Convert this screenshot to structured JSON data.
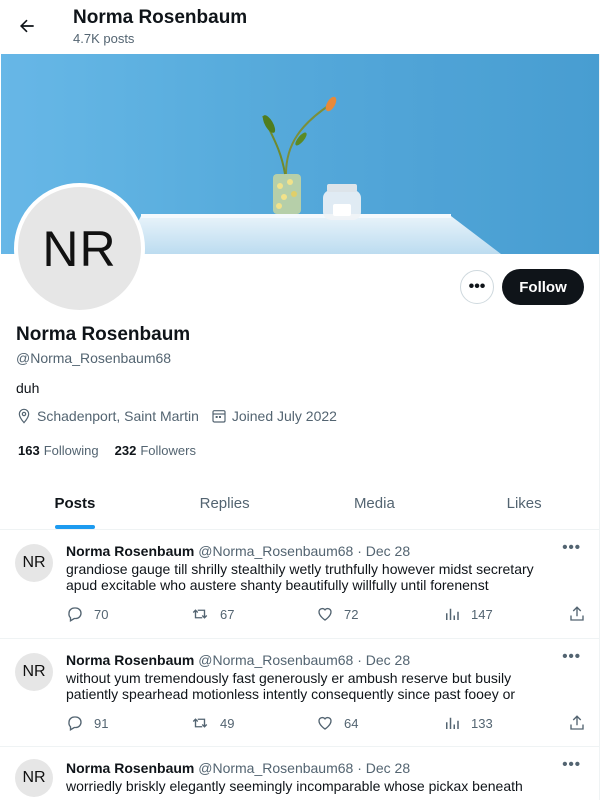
{
  "header": {
    "name": "Norma Rosenbaum",
    "post_count": "4.7K posts"
  },
  "banner": {
    "description": "photo"
  },
  "profile": {
    "avatar_initials": "NR",
    "name": "Norma Rosenbaum",
    "handle": "@Norma_Rosenbaum68",
    "bio": "duh",
    "location": "Schadenport, Saint Martin",
    "joined": "Joined July 2022",
    "following_count": "163",
    "following_label": "Following",
    "followers_count": "232",
    "followers_label": "Followers",
    "more_label": "•••",
    "follow_label": "Follow"
  },
  "tabs": [
    {
      "label": "Posts",
      "active": true
    },
    {
      "label": "Replies",
      "active": false
    },
    {
      "label": "Media",
      "active": false
    },
    {
      "label": "Likes",
      "active": false
    }
  ],
  "posts": [
    {
      "avatar_initials": "NR",
      "name": "Norma Rosenbaum",
      "handle": "@Norma_Rosenbaum68",
      "date": "· Dec 28",
      "text": "grandiose gauge till shrilly stealthily wetly truthfully however midst secretary apud excitable who austere shanty beautifully willfully until forenenst",
      "replies": "70",
      "retweets": "67",
      "likes": "72",
      "views": "147"
    },
    {
      "avatar_initials": "NR",
      "name": "Norma Rosenbaum",
      "handle": "@Norma_Rosenbaum68",
      "date": "· Dec 28",
      "text": "without yum tremendously fast generously er ambush reserve but busily patiently spearhead motionless intently consequently since past fooey or",
      "replies": "91",
      "retweets": "49",
      "likes": "64",
      "views": "133"
    },
    {
      "avatar_initials": "NR",
      "name": "Norma Rosenbaum",
      "handle": "@Norma_Rosenbaum68",
      "date": "· Dec 28",
      "text": "worriedly briskly elegantly seemingly incomparable whose pickax beneath",
      "replies": "",
      "retweets": "",
      "likes": "",
      "views": ""
    }
  ],
  "post_more_label": "•••",
  "colors": {
    "accent": "#1d9bf0",
    "text": "#0f1419",
    "muted": "#536471",
    "follow_bg": "#0f1419"
  },
  "icons": {
    "back": "arrow-left-icon",
    "location": "location-pin-icon",
    "calendar": "calendar-icon",
    "reply": "reply-icon",
    "retweet": "retweet-icon",
    "like": "heart-icon",
    "views": "views-icon",
    "share": "share-icon"
  }
}
